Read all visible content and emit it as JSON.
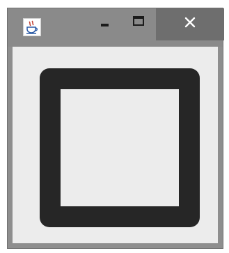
{
  "window": {
    "title": "",
    "icons": {
      "app": "java-coffee-cup-icon",
      "minimize": "minimize-icon",
      "maximize": "maximize-icon",
      "close": "close-icon"
    },
    "colors": {
      "frame": "#8e8e8e",
      "close_button": "#6e6e6e",
      "client": "#ececec",
      "shape_stroke": "#262626"
    }
  },
  "canvas": {
    "shape": "rounded-square-outline"
  }
}
